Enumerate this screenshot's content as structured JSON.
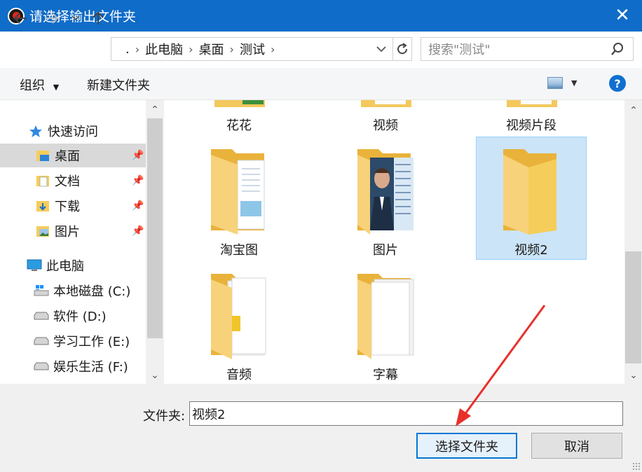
{
  "window": {
    "title": "请选择输出文件夹"
  },
  "address": {
    "segments": [
      ".",
      "此电脑",
      "桌面",
      "测试"
    ]
  },
  "search": {
    "placeholder": "搜索\"测试\""
  },
  "toolbar": {
    "organize": "组织",
    "new_folder": "新建文件夹"
  },
  "sidebar": {
    "quick_access": "快速访问",
    "items": [
      {
        "label": "桌面",
        "pinned": true,
        "selected": true,
        "icon": "desktop-folder-icon"
      },
      {
        "label": "文档",
        "pinned": true,
        "icon": "documents-folder-icon"
      },
      {
        "label": "下载",
        "pinned": true,
        "icon": "downloads-folder-icon"
      },
      {
        "label": "图片",
        "pinned": true,
        "icon": "pictures-folder-icon"
      }
    ],
    "this_pc": "此电脑",
    "drives": [
      {
        "label": "本地磁盘 (C:)",
        "icon": "windows-drive-icon"
      },
      {
        "label": "软件 (D:)",
        "icon": "drive-icon"
      },
      {
        "label": "学习工作 (E:)",
        "icon": "drive-icon"
      },
      {
        "label": "娱乐生活 (F:)",
        "icon": "drive-icon"
      }
    ]
  },
  "folders": [
    {
      "label": "花花",
      "thumb": "image"
    },
    {
      "label": "视频",
      "thumb": "docs"
    },
    {
      "label": "视频片段",
      "thumb": "docs"
    },
    {
      "label": "淘宝图",
      "thumb": "docs-blue"
    },
    {
      "label": "图片",
      "thumb": "portrait"
    },
    {
      "label": "视频2",
      "thumb": "empty",
      "selected": true
    },
    {
      "label": "音频",
      "thumb": "audio"
    },
    {
      "label": "字幕",
      "thumb": "docs"
    }
  ],
  "footer": {
    "folder_label": "文件夹:",
    "folder_value": "视频2",
    "select_button": "选择文件夹",
    "cancel_button": "取消"
  },
  "colors": {
    "titlebar": "#0f6cc8",
    "selection": "#cce4f7",
    "accent": "#0078d7",
    "arrow": "#e8302a"
  }
}
